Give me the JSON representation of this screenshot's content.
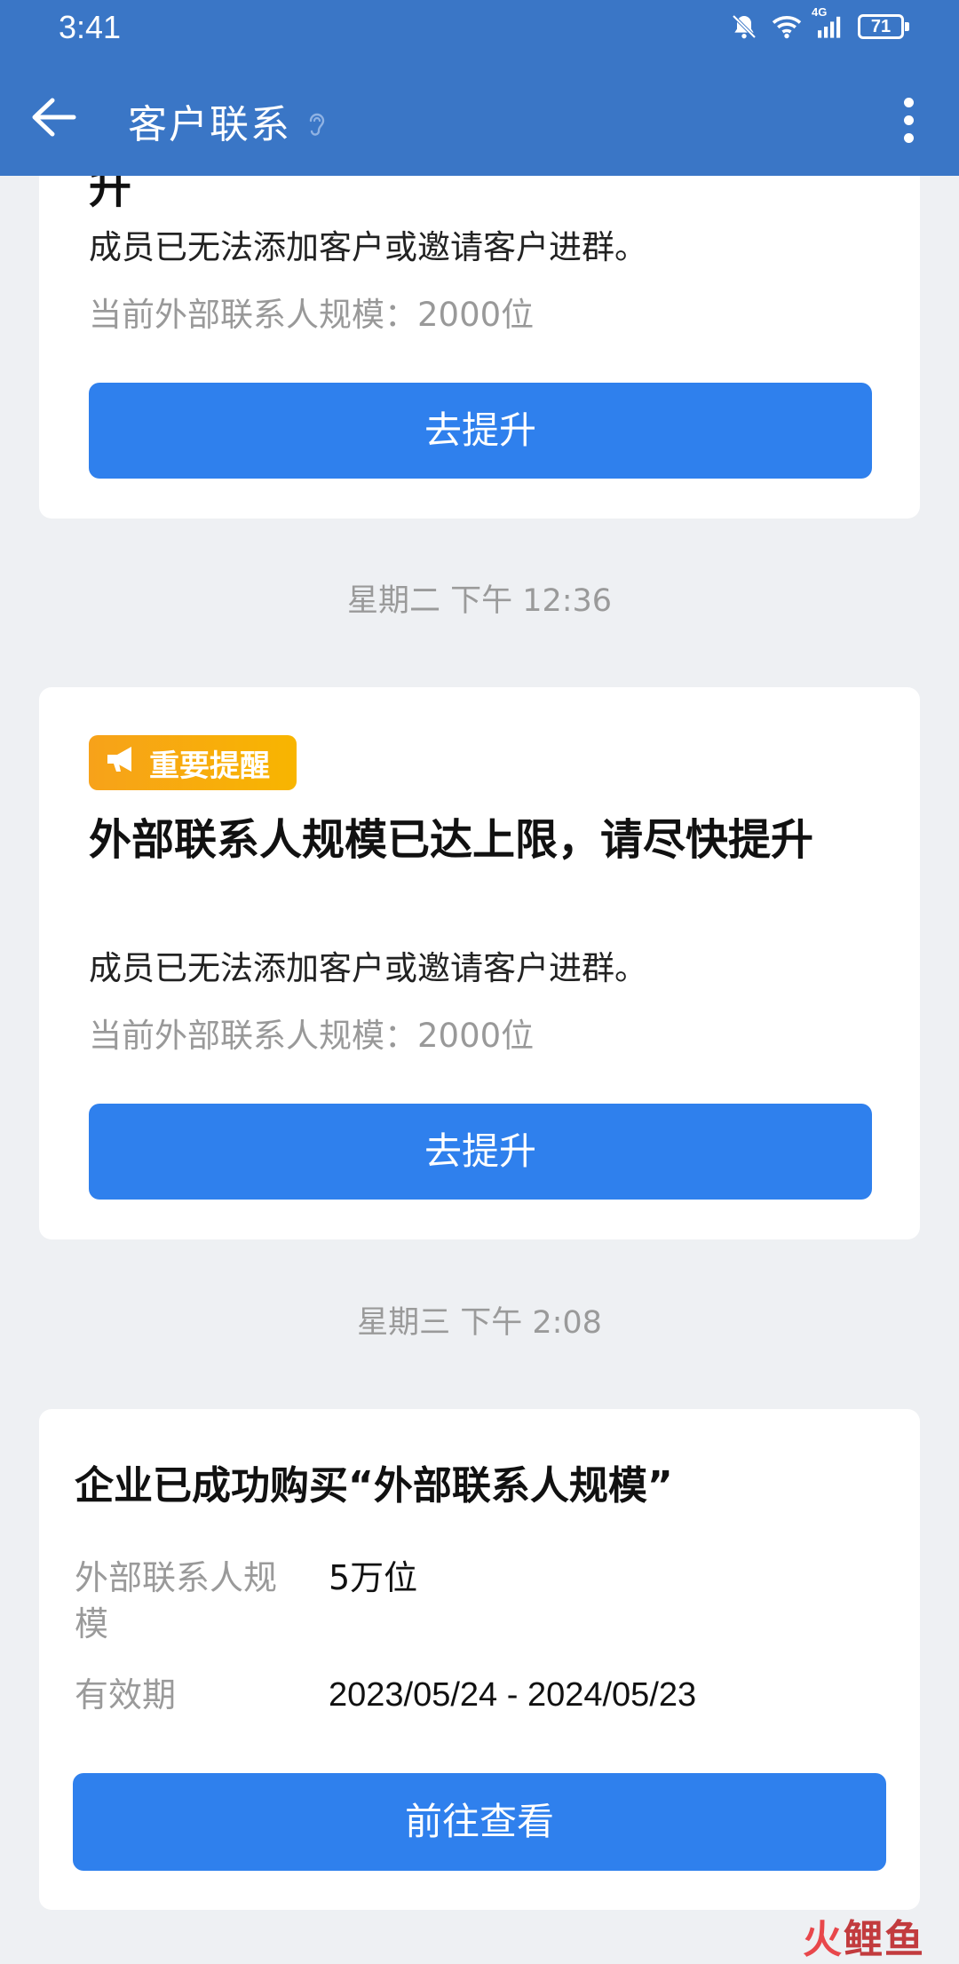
{
  "status_bar": {
    "time": "3:41",
    "network": "4G",
    "battery": "71"
  },
  "header": {
    "title": "客户联系"
  },
  "messages": [
    {
      "title_tail": "升",
      "description": "成员已无法添加客户或邀请客户进群。",
      "scale_text": "当前外部联系人规模：2000位",
      "button_label": "去提升"
    },
    {
      "timestamp": "星期二  下午 12:36",
      "badge": "重要提醒",
      "title": "外部联系人规模已达上限，请尽快提升",
      "description": "成员已无法添加客户或邀请客户进群。",
      "scale_text": "当前外部联系人规模：2000位",
      "button_label": "去提升"
    },
    {
      "timestamp": "星期三  下午 2:08",
      "title": "企业已成功购买“外部联系人规模”",
      "rows": [
        {
          "label": "外部联系人规模",
          "value": "5万位"
        },
        {
          "label": "有效期",
          "value": "2023/05/24 - 2024/05/23"
        }
      ],
      "button_label": "前往查看"
    }
  ],
  "watermark": {
    "text1": "火",
    "text2": "鲤鱼"
  },
  "icons": {
    "back": "arrow-left-icon",
    "ear": "ear-icon",
    "more": "more-vertical-icon",
    "mute": "bell-off-icon",
    "wifi": "wifi-icon",
    "signal": "signal-icon",
    "badge": "megaphone-icon"
  },
  "colors": {
    "header": "#3a76c6",
    "button": "#2f80ed",
    "badge": "#f8a91a",
    "background": "#eef0f3"
  }
}
